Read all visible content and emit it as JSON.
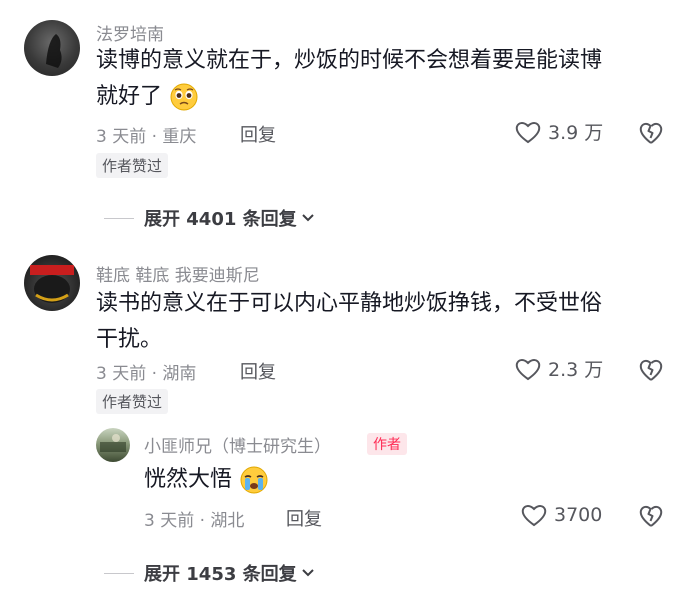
{
  "comments": [
    {
      "username": "法罗培南",
      "text_line1": "读博的意义就在于，炒饭的时候不会想着要是能读博",
      "text_line2": "就好了",
      "emoji": "pleading-face-icon",
      "time_location": "3 天前 · 重庆",
      "reply_label": "回复",
      "likes": "3.9 万",
      "author_liked": "作者赞过",
      "expand_replies": "展开 4401 条回复"
    },
    {
      "username": "鞋底 鞋底 我要迪斯尼",
      "text_line1": "读书的意义在于可以内心平静地炒饭挣钱，不受世俗",
      "text_line2": "干扰。",
      "time_location": "3 天前 · 湖南",
      "reply_label": "回复",
      "likes": "2.3 万",
      "author_liked": "作者赞过",
      "reply": {
        "username": "小匪师兄（博士研究生）",
        "author_tag": "作者",
        "text": "恍然大悟",
        "emoji": "loudly-crying-face-icon",
        "time_location": "3 天前 · 湖北",
        "reply_label": "回复",
        "likes": "3700"
      },
      "expand_replies": "展开 1453 条回复"
    }
  ],
  "colors": {
    "text_primary": "#161823",
    "text_secondary": "#8a8b91",
    "author_tag": "#fe2c55",
    "author_tag_bg": "#fde6ea"
  }
}
